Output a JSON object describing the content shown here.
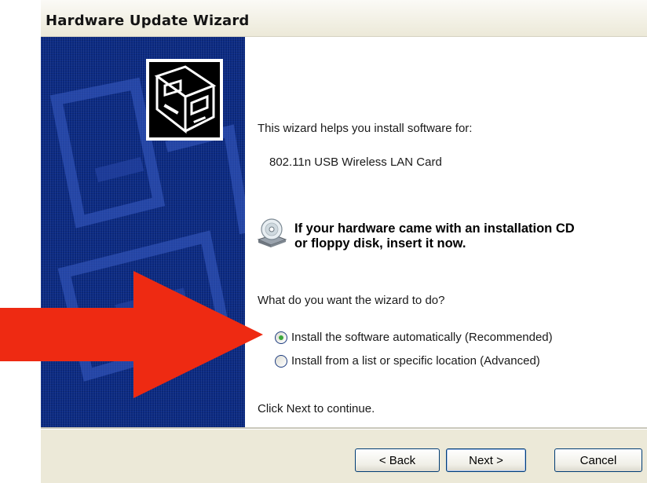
{
  "window": {
    "title": "Hardware Update Wizard"
  },
  "content": {
    "intro": "This wizard helps you install software for:",
    "device_name": "802.11n USB Wireless LAN Card",
    "cd_prompt_line1": "If your hardware came with an installation CD",
    "cd_prompt_line2": "or floppy disk, insert it now.",
    "question": "What do you want the wizard to do?",
    "options": [
      {
        "label": "Install the software automatically (Recommended)",
        "selected": true
      },
      {
        "label": "Install from a list or specific location (Advanced)",
        "selected": false
      }
    ],
    "footer": "Click Next to continue."
  },
  "buttons": {
    "back": "< Back",
    "next": "Next >",
    "cancel": "Cancel"
  },
  "colors": {
    "side_panel": "#0b2a83",
    "annotation_arrow": "#ee2a12",
    "radio_selected": "#3ca83c"
  },
  "icons": {
    "wizard_logo": "hardware-box-icon",
    "cd": "cd-drive-icon",
    "annotation": "red-arrow-icon"
  }
}
